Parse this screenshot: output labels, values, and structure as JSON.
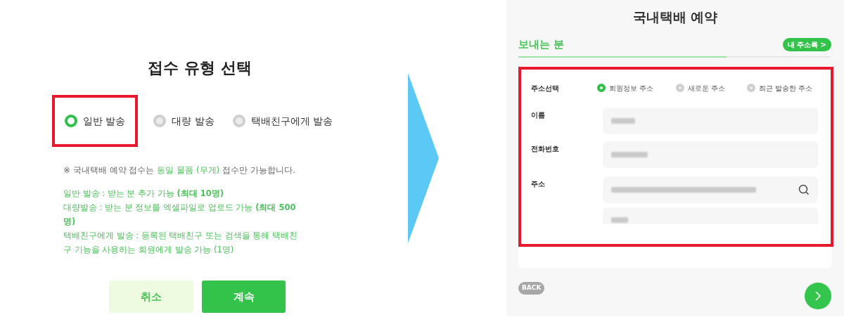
{
  "left": {
    "title": "접수 유형 선택",
    "options": [
      {
        "label": "일반 발송",
        "selected": true,
        "highlighted": true
      },
      {
        "label": "대량 발송",
        "selected": false,
        "highlighted": false
      },
      {
        "label": "택배친구에게 발송",
        "selected": false,
        "highlighted": false
      }
    ],
    "note": [
      {
        "text": "※ 국내택배 예약 접수는 ",
        "accent": false
      },
      {
        "text": "동일 물품 (무게)",
        "accent": true
      },
      {
        "text": " 접수만 가능합니다.",
        "accent": false
      }
    ],
    "details": [
      "일반 발송 : 받는 분 추가 가능 **(최대 10명)**",
      "대량발송 : 받는 분 정보를 엑셀파일로 업로드 가능 **(최대 500명)**",
      "택배친구에게 발송 : 등록된 택배친구 또는 검색을 통해 택배친구 기능을 사용하는 회원에게 발송 가능 (1명)"
    ],
    "buttons": [
      {
        "label": "취소",
        "kind": "secondary"
      },
      {
        "label": "계속",
        "kind": "primary"
      }
    ]
  },
  "right": {
    "title": "국내택배 예약",
    "section": "보내는 분",
    "address_book": "내 주소록 >",
    "highlighted": true,
    "address_label": "주소선택",
    "address_options": [
      {
        "label": "회원정보 주소",
        "selected": true
      },
      {
        "label": "새로운 주소",
        "selected": false
      },
      {
        "label": "최근 발송한 주소",
        "selected": false
      }
    ],
    "fields": [
      {
        "label": "이름",
        "kind": "text"
      },
      {
        "label": "전화번호",
        "kind": "text"
      },
      {
        "label": "주소",
        "kind": "search"
      }
    ],
    "back": "BACK"
  }
}
